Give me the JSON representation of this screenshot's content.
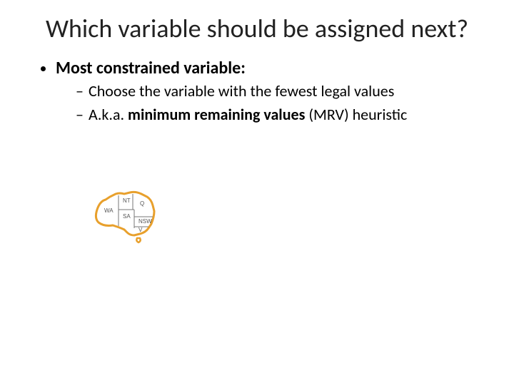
{
  "title": "Which variable should be assigned next?",
  "bullet1": "Most constrained variable:",
  "sub1": "Choose the variable with the fewest legal values",
  "sub2_prefix": "A.k.a. ",
  "sub2_bold": "minimum remaining values",
  "sub2_suffix": " (MRV) heuristic",
  "map": {
    "labels": {
      "wa": "WA",
      "nt": "NT",
      "sa": "SA",
      "q": "Q",
      "nsw": "NSW",
      "v": "V"
    }
  }
}
